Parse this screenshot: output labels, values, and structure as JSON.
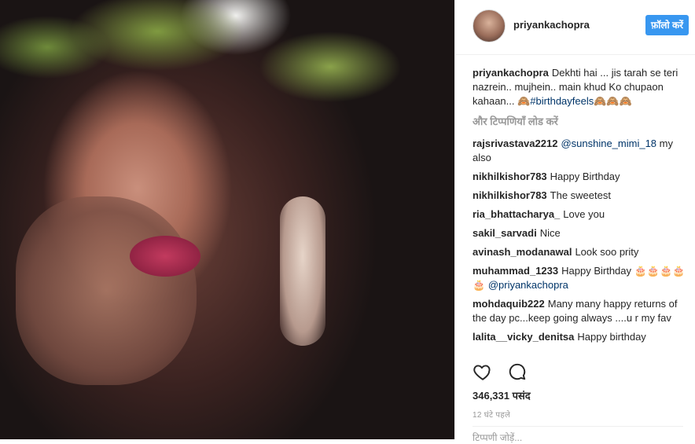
{
  "post": {
    "username": "priyankachopra",
    "follow_label": "फ़ॉलो करें",
    "caption_user": "priyankachopra",
    "caption_text": "Dekhti hai ... jis tarah se teri nazrein.. mujhein.. main khud Ko chupaon kahaan... ",
    "caption_hashtag": "🙈#birthdayfeels🙈🙈🙈",
    "load_more": "और टिप्पणियाँ लोड करें",
    "likes": "346,331 पसंद",
    "time_ago": "12 घंटे पहले",
    "add_comment_placeholder": "टिप्पणी जोड़ें..."
  },
  "comments": [
    {
      "user": "rajsrivastava2212",
      "mention": "@sunshine_mimi_18",
      "text": "my also"
    },
    {
      "user": "nikhilkishor783",
      "text": "Happy Birthday"
    },
    {
      "user": "nikhilkishor783",
      "text": "The sweetest"
    },
    {
      "user": "ria_bhattacharya_",
      "text": "Love you"
    },
    {
      "user": "sakil_sarvadi",
      "text": "Nice"
    },
    {
      "user": "avinash_modanawal",
      "text": "Look soo prity"
    },
    {
      "user": "muhammad_1233",
      "text": "Happy Birthday 🎂🎂🎂🎂🎂",
      "mention": "@priyankachopra"
    },
    {
      "user": "mohdaquib222",
      "text": "Many many happy returns of the day pc...keep going always ....u r my fav"
    },
    {
      "user": "lalita__vicky_denitsa",
      "text": "Happy birthday"
    }
  ],
  "icons": {
    "like": "heart-icon",
    "comment": "comment-bubble-icon"
  },
  "colors": {
    "follow_button": "#3897f0",
    "link": "#003569",
    "muted": "#999999"
  }
}
